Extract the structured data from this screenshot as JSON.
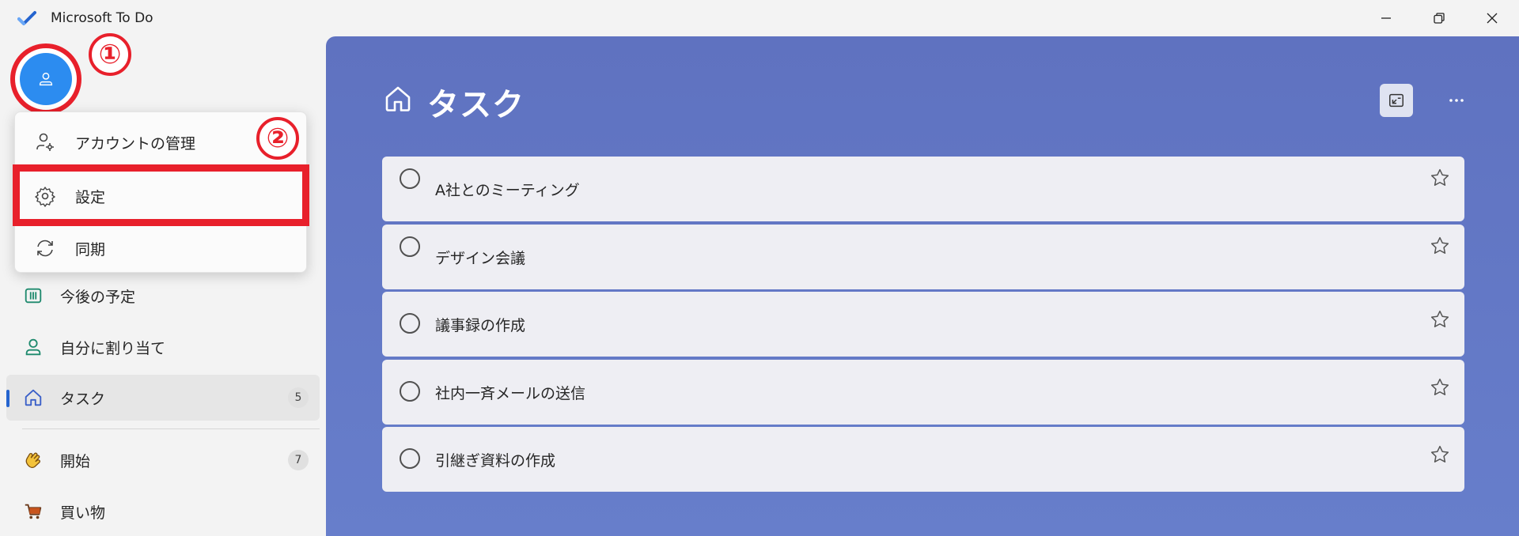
{
  "app": {
    "title": "Microsoft To Do",
    "accent_color": "#2564cf",
    "main_bg_color": "#6275c3"
  },
  "window_controls": [
    "minimize-icon",
    "restore-icon",
    "close-icon"
  ],
  "annotations": {
    "marker_1": "①",
    "marker_2": "②",
    "highlight_color": "#e8202b"
  },
  "account_menu": {
    "items": [
      {
        "label": "アカウントの管理",
        "icon": "account-settings-icon"
      },
      {
        "label": "設定",
        "icon": "gear-icon"
      },
      {
        "label": "同期",
        "icon": "sync-icon"
      }
    ]
  },
  "sidebar": {
    "items": [
      {
        "label": "今後の予定",
        "icon": "calendar-icon"
      },
      {
        "label": "自分に割り当て",
        "icon": "person-icon"
      },
      {
        "label": "タスク",
        "icon": "home-icon",
        "count": "5",
        "active": true
      },
      {
        "label": "開始",
        "icon": "waving-hand-icon",
        "count": "7"
      },
      {
        "label": "買い物",
        "icon": "shopping-cart-icon"
      }
    ]
  },
  "main": {
    "title": "タスク",
    "title_icon": "home-icon",
    "tasks": [
      {
        "label": "A社とのミーティング"
      },
      {
        "label": "デザイン会議"
      },
      {
        "label": "議事録の作成"
      },
      {
        "label": "社内一斉メールの送信"
      },
      {
        "label": "引継ぎ資料の作成"
      }
    ]
  }
}
